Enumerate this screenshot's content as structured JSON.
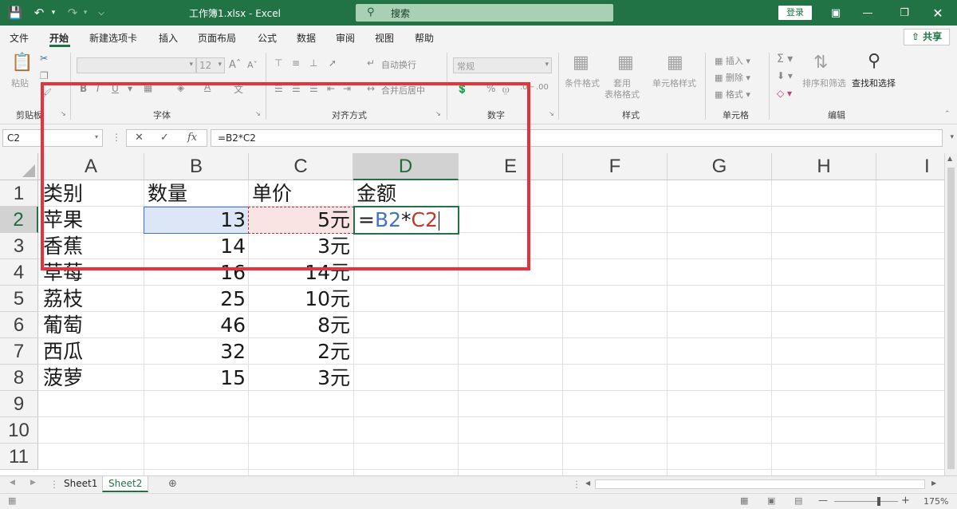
{
  "titlebar": {
    "doc_title": "工作簿1.xlsx - Excel",
    "search_placeholder": "搜索",
    "login_label": "登录"
  },
  "menu": {
    "tabs": [
      "文件",
      "开始",
      "新建选项卡",
      "插入",
      "页面布局",
      "公式",
      "数据",
      "审阅",
      "视图",
      "帮助"
    ],
    "active_tab": "开始",
    "share_label": "共享"
  },
  "ribbon": {
    "clipboard": {
      "paste_label": "粘贴",
      "group_label": "剪贴板"
    },
    "font": {
      "size_value": "12",
      "group_label": "字体"
    },
    "alignment": {
      "wrap_label": "自动换行",
      "merge_label": "合并后居中",
      "group_label": "对齐方式"
    },
    "number": {
      "format_value": "常规",
      "group_label": "数字"
    },
    "styles": {
      "conditional_label": "条件格式",
      "table_label": "套用\n表格格式",
      "cell_styles_label": "单元格样式",
      "group_label": "样式"
    },
    "cells": {
      "insert_label": "插入",
      "delete_label": "删除",
      "format_label": "格式",
      "group_label": "单元格"
    },
    "editing": {
      "sort_filter_label": "排序和筛选",
      "find_select_label": "查找和选择",
      "group_label": "编辑"
    }
  },
  "formula_bar": {
    "name_box": "C2",
    "fx_label": "fx",
    "formula": "=B2*C2"
  },
  "grid": {
    "columns": [
      "A",
      "B",
      "C",
      "D",
      "E",
      "F",
      "G",
      "H",
      "I"
    ],
    "selected_column": "D",
    "rows": [
      "1",
      "2",
      "3",
      "4",
      "5",
      "6",
      "7",
      "8",
      "9",
      "10",
      "11"
    ],
    "selected_row": "2",
    "headers": [
      "类别",
      "数量",
      "单价",
      "金额"
    ],
    "data": [
      [
        "苹果",
        "13",
        "5元"
      ],
      [
        "香蕉",
        "14",
        "3元"
      ],
      [
        "草莓",
        "16",
        "14元"
      ],
      [
        "荔枝",
        "25",
        "10元"
      ],
      [
        "葡萄",
        "46",
        "8元"
      ],
      [
        "西瓜",
        "32",
        "2元"
      ],
      [
        "菠萝",
        "15",
        "3元"
      ]
    ],
    "editing_formula": {
      "eq": "=",
      "ref1": "B2",
      "op": "*",
      "ref2": "C2"
    }
  },
  "sheets": {
    "tabs": [
      "Sheet1",
      "Sheet2"
    ],
    "active": "Sheet2"
  },
  "status": {
    "zoom": "175%"
  },
  "colors": {
    "excel_green": "#217346",
    "ref_blue": "#4472c4",
    "ref_red": "#c0392b",
    "annotation_red": "#e8313b"
  }
}
